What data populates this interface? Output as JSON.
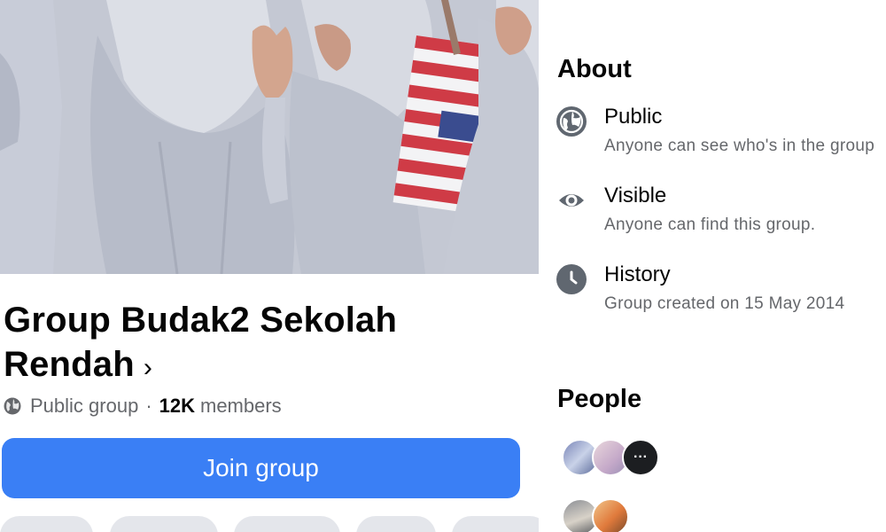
{
  "group": {
    "name": "Group Budak2 Sekolah Rendah",
    "chevron": "›",
    "privacy": "Public group",
    "separator": "·",
    "member_count": "12K",
    "members_label": "members",
    "join_label": "Join group"
  },
  "about": {
    "title": "About",
    "items": [
      {
        "icon": "globe-icon",
        "label": "Public",
        "description": "Anyone can see who's in the group"
      },
      {
        "icon": "eye-icon",
        "label": "Visible",
        "description": "Anyone can find this group."
      },
      {
        "icon": "clock-icon",
        "label": "History",
        "description": "Group created on 15 May 2014"
      }
    ]
  },
  "people": {
    "title": "People",
    "overflow_glyph": "···"
  },
  "colors": {
    "primary_button": "#3a7ff5",
    "secondary_text": "#65676b",
    "icon_bg": "#606770"
  }
}
